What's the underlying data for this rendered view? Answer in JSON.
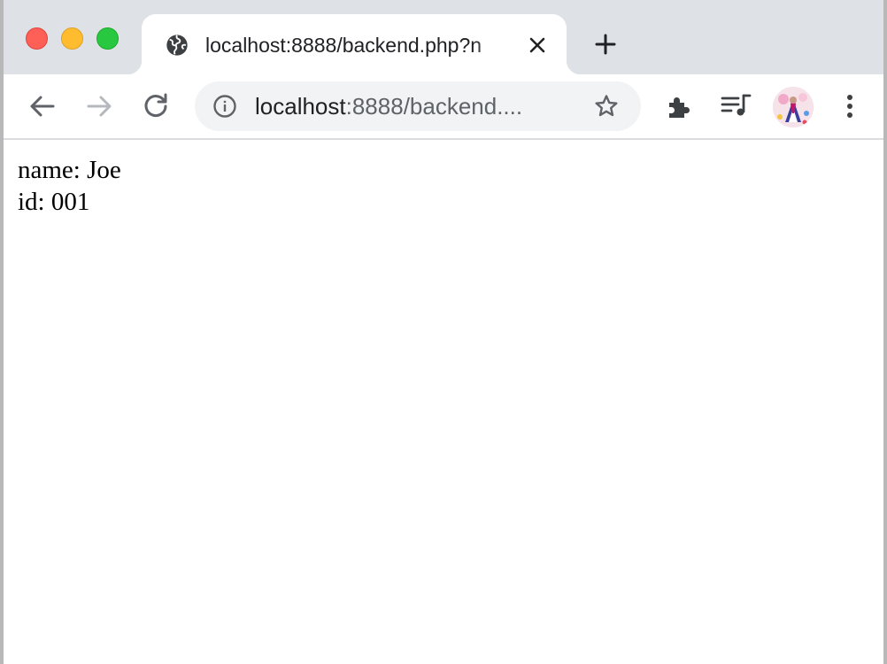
{
  "window": {
    "controls": [
      "close",
      "minimize",
      "maximize"
    ],
    "colors": {
      "close": "#fe5f57",
      "minimize": "#febc2e",
      "maximize": "#28c840"
    }
  },
  "tab": {
    "title": "localhost:8888/backend.php?n",
    "favicon": "globe-icon",
    "close_icon": "close-icon"
  },
  "new_tab_icon": "plus-icon",
  "toolbar": {
    "back_icon": "back-arrow-icon",
    "forward_icon": "forward-arrow-icon",
    "reload_icon": "reload-icon",
    "extensions_icon": "puzzle-icon",
    "media_icon": "media-queue-icon",
    "menu_icon": "kebab-menu-icon"
  },
  "omnibox": {
    "info_icon": "info-icon",
    "host": "localhost",
    "rest": ":8888/backend....",
    "star_icon": "star-icon"
  },
  "page": {
    "lines": [
      {
        "text": "name: Joe"
      },
      {
        "text": "id: 001"
      }
    ]
  }
}
